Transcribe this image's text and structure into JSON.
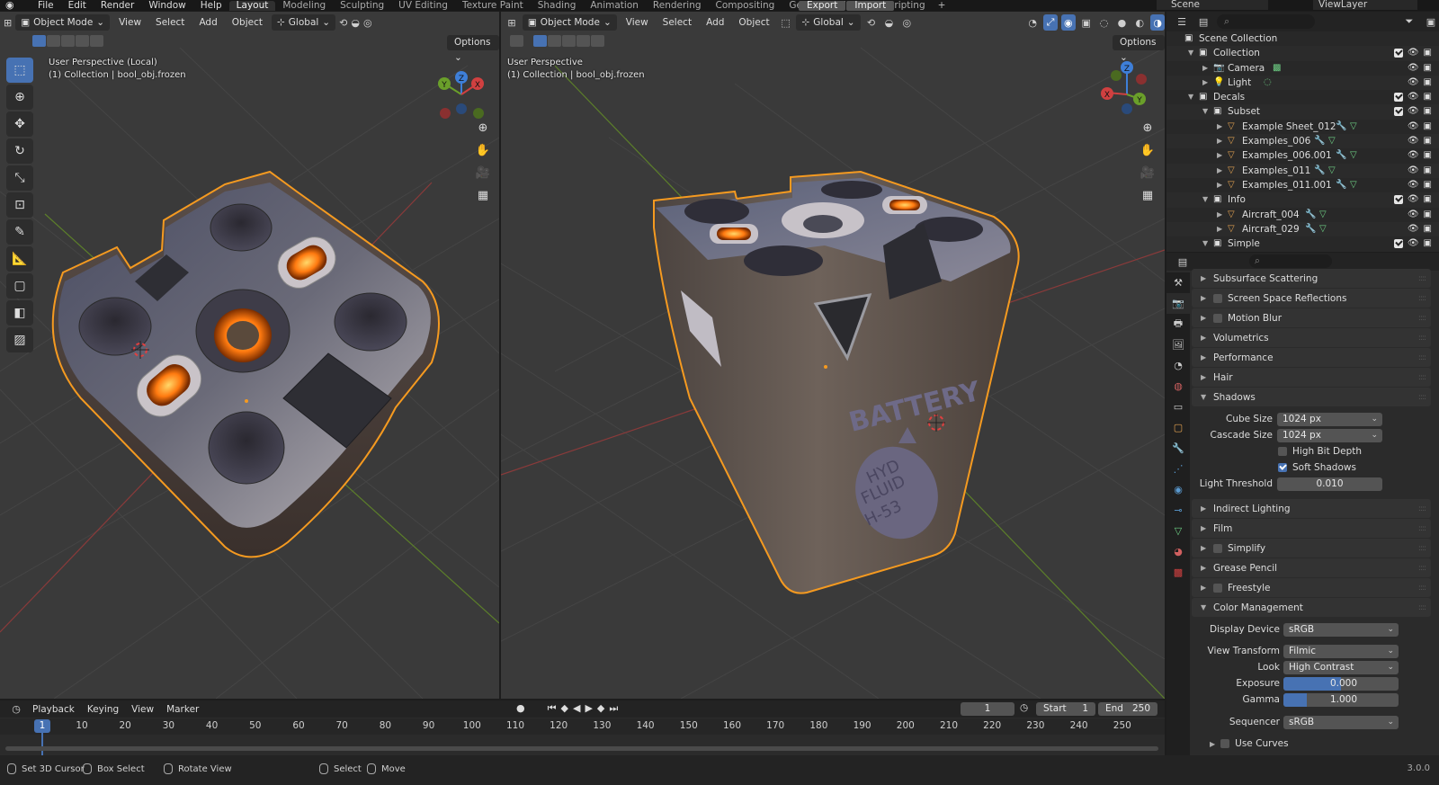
{
  "topbar": {
    "menus": [
      "File",
      "Edit",
      "Render",
      "Window",
      "Help"
    ],
    "workspaces": [
      "Layout",
      "Modeling",
      "Sculpting",
      "UV Editing",
      "Texture Paint",
      "Shading",
      "Animation",
      "Rendering",
      "Compositing",
      "Geometry Nodes",
      "Scripting"
    ],
    "active_workspace": "Layout",
    "export_label": "Export",
    "import_label": "Import",
    "scene": "Scene",
    "view_layer": "ViewLayer"
  },
  "viewport_left": {
    "mode": "Object Mode",
    "menus": [
      "View",
      "Select",
      "Add",
      "Object"
    ],
    "orientation": "Global",
    "options_label": "Options",
    "perspective": "User Perspective (Local)",
    "collection_info": "(1) Collection | bool_obj.frozen"
  },
  "viewport_right": {
    "mode": "Object Mode",
    "menus": [
      "View",
      "Select",
      "Add",
      "Object"
    ],
    "orientation": "Global",
    "options_label": "Options",
    "perspective": "User Perspective",
    "collection_info": "(1) Collection | bool_obj.frozen",
    "decal_text": "BATTERY",
    "label_text": [
      "HYD",
      "FLUID",
      "H-53"
    ]
  },
  "outliner": {
    "rows": [
      {
        "label": "Scene Collection"
      },
      {
        "label": "Collection"
      },
      {
        "label": "Camera"
      },
      {
        "label": "Light"
      },
      {
        "label": "Decals"
      },
      {
        "label": "Subset"
      },
      {
        "label": "Example Sheet_012"
      },
      {
        "label": "Examples_006"
      },
      {
        "label": "Examples_006.001"
      },
      {
        "label": "Examples_011"
      },
      {
        "label": "Examples_011.001"
      },
      {
        "label": "Info"
      },
      {
        "label": "Aircraft_004"
      },
      {
        "label": "Aircraft_029"
      },
      {
        "label": "Simple"
      }
    ]
  },
  "properties": {
    "panels": {
      "subsurface": "Subsurface Scattering",
      "ssr": "Screen Space Reflections",
      "motion_blur": "Motion Blur",
      "volumetrics": "Volumetrics",
      "performance": "Performance",
      "hair": "Hair",
      "shadows": "Shadows",
      "indirect": "Indirect Lighting",
      "film": "Film",
      "simplify": "Simplify",
      "grease_pencil": "Grease Pencil",
      "freestyle": "Freestyle",
      "color_management": "Color Management"
    },
    "shadows": {
      "cube_size_label": "Cube Size",
      "cube_size": "1024 px",
      "cascade_size_label": "Cascade Size",
      "cascade_size": "1024 px",
      "high_bit_depth": "High Bit Depth",
      "soft_shadows": "Soft Shadows",
      "light_threshold_label": "Light Threshold",
      "light_threshold": "0.010"
    },
    "color_management": {
      "display_device_label": "Display Device",
      "display_device": "sRGB",
      "view_transform_label": "View Transform",
      "view_transform": "Filmic",
      "look_label": "Look",
      "look": "High Contrast",
      "exposure_label": "Exposure",
      "exposure": "0.000",
      "gamma_label": "Gamma",
      "gamma": "1.000",
      "sequencer_label": "Sequencer",
      "sequencer": "sRGB",
      "use_curves": "Use Curves"
    }
  },
  "timeline": {
    "menus": [
      "Playback",
      "Keying",
      "View",
      "Marker"
    ],
    "current_frame": "1",
    "start_label": "Start",
    "start": "1",
    "end_label": "End",
    "end": "250",
    "ticks": [
      "10",
      "20",
      "30",
      "40",
      "50",
      "60",
      "70",
      "80",
      "90",
      "100",
      "110",
      "120",
      "130",
      "140",
      "150",
      "160",
      "170",
      "180",
      "190",
      "200",
      "210",
      "220",
      "230",
      "240",
      "250"
    ]
  },
  "statusbar": {
    "set_cursor": "Set 3D Cursor",
    "box_select": "Box Select",
    "rotate_view": "Rotate View",
    "select": "Select",
    "move": "Move",
    "version": "3.0.0"
  }
}
